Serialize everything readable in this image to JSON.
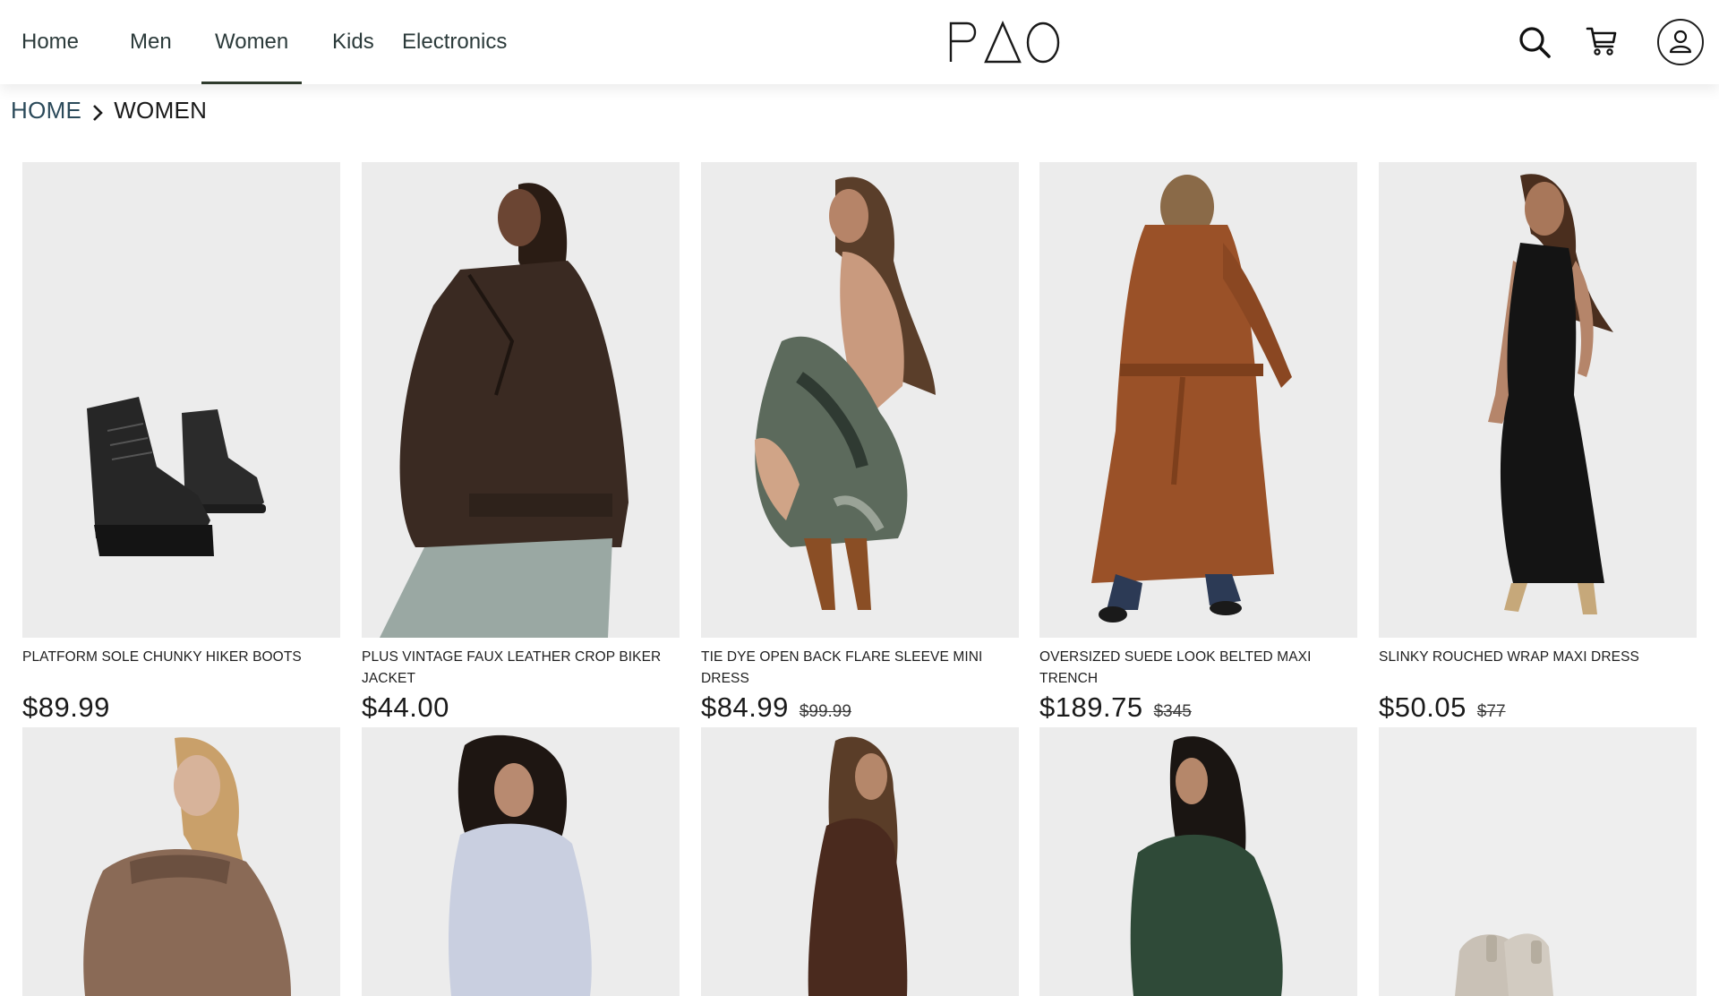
{
  "nav": {
    "items": [
      {
        "label": "Home"
      },
      {
        "label": "Men"
      },
      {
        "label": "Women"
      },
      {
        "label": "Kids"
      },
      {
        "label": "Electronics"
      }
    ],
    "active": "Women"
  },
  "brand": {
    "logo_text": "PAO"
  },
  "header_icons": [
    "search-icon",
    "cart-icon",
    "user-icon"
  ],
  "breadcrumb": {
    "home": "HOME",
    "current": "WOMEN"
  },
  "products": [
    {
      "name": "PLATFORM SOLE CHUNKY HIKER BOOTS",
      "price": "$89.99",
      "old_price": ""
    },
    {
      "name": "PLUS VINTAGE FAUX LEATHER CROP BIKER JACKET",
      "price": "$44.00",
      "old_price": ""
    },
    {
      "name": "TIE DYE OPEN BACK FLARE SLEEVE MINI DRESS",
      "price": "$84.99",
      "old_price": "$99.99"
    },
    {
      "name": "OVERSIZED SUEDE LOOK BELTED MAXI TRENCH",
      "price": "$189.75",
      "old_price": "$345"
    },
    {
      "name": "SLINKY ROUCHED WRAP MAXI DRESS",
      "price": "$50.05",
      "old_price": "$77"
    }
  ],
  "colors": {
    "accent": "#2e3a2c",
    "card_bg": "#ebebeb",
    "breadcrumb_link": "#2b4a5a"
  }
}
